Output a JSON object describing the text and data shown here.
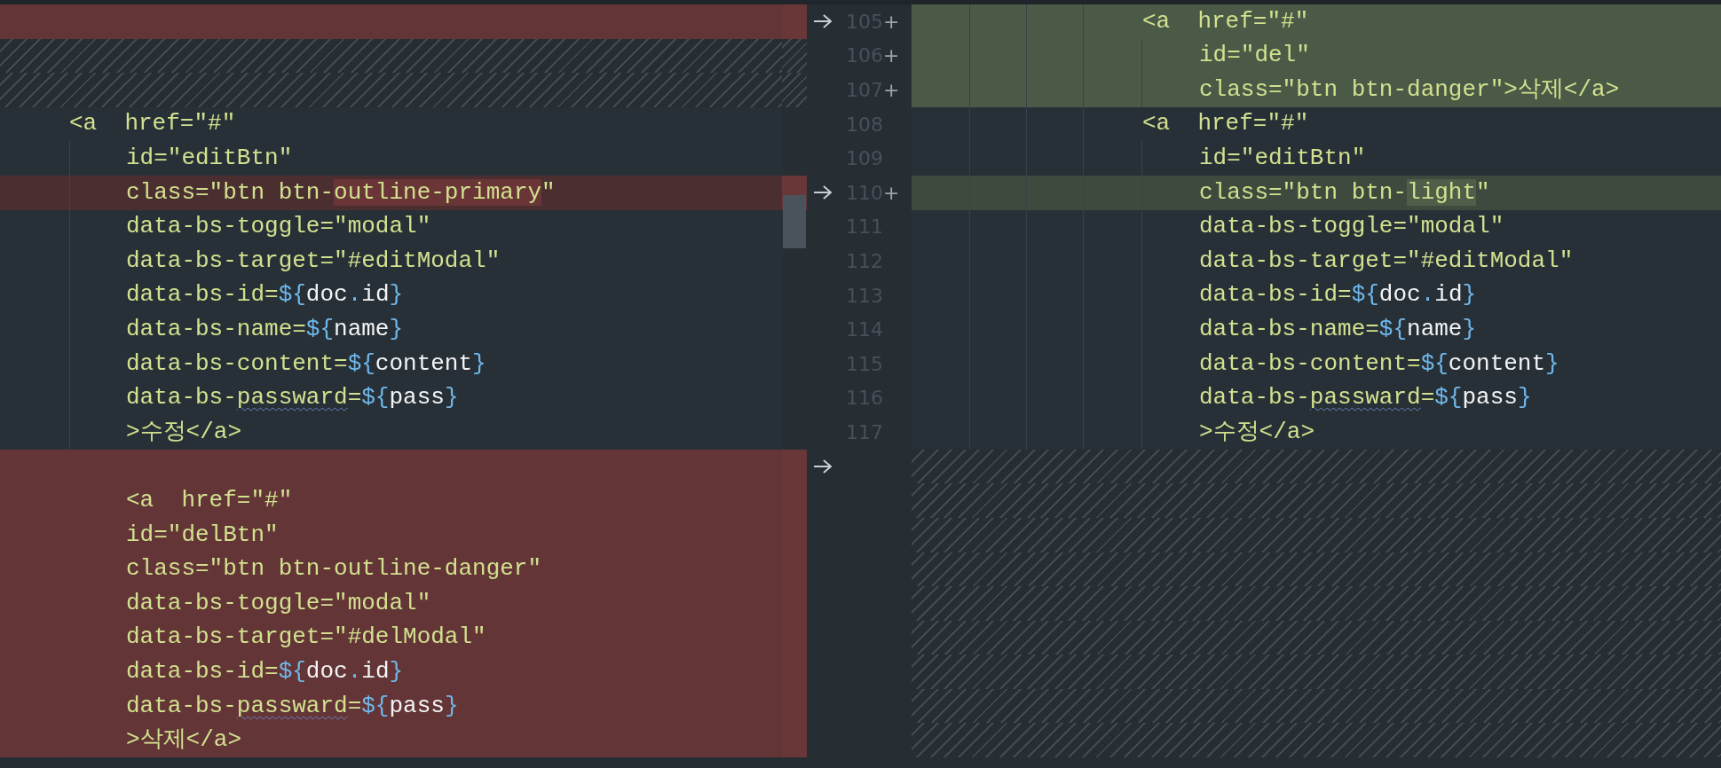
{
  "rows": [
    {
      "arrow": true,
      "left": {
        "kind": "removed",
        "indented": false
      },
      "right": {
        "number": "105",
        "marker": "+",
        "kind": "added",
        "indented": false,
        "tokens": [
          {
            "t": "<a  href=\"#\"",
            "kind": "plain"
          }
        ]
      }
    },
    {
      "arrow": false,
      "left": {
        "kind": "filler",
        "indented": false
      },
      "right": {
        "number": "106",
        "marker": "+",
        "kind": "added",
        "indented": true,
        "tokens": [
          {
            "t": "id=\"del\"",
            "kind": "plain"
          }
        ]
      }
    },
    {
      "arrow": false,
      "left": {
        "kind": "filler",
        "indented": false
      },
      "right": {
        "number": "107",
        "marker": "+",
        "kind": "added",
        "indented": true,
        "tokens": [
          {
            "t": "class=\"btn btn-danger\">삭제</a>",
            "kind": "plain"
          }
        ]
      }
    },
    {
      "arrow": false,
      "left": {
        "kind": "context",
        "indented": false,
        "tokens": [
          {
            "t": "<a  href=\"#\"",
            "kind": "plain"
          }
        ]
      },
      "right": {
        "number": "108",
        "kind": "context",
        "indented": false,
        "tokens": [
          {
            "t": "<a  href=\"#\"",
            "kind": "plain"
          }
        ]
      }
    },
    {
      "arrow": false,
      "left": {
        "kind": "context",
        "indented": true,
        "tokens": [
          {
            "t": "id=\"editBtn\"",
            "kind": "plain"
          }
        ]
      },
      "right": {
        "number": "109",
        "kind": "context",
        "indented": true,
        "tokens": [
          {
            "t": "id=\"editBtn\"",
            "kind": "plain"
          }
        ]
      }
    },
    {
      "arrow": true,
      "left": {
        "kind": "modified",
        "indented": true,
        "tokens": [
          {
            "t": "class=\"btn btn-",
            "kind": "plain"
          },
          {
            "t": "outline-primary",
            "kind": "changed"
          },
          {
            "t": "\"",
            "kind": "plain"
          }
        ]
      },
      "right": {
        "number": "110",
        "marker": "+",
        "kind": "modified",
        "indented": true,
        "tokens": [
          {
            "t": "class=\"btn btn-",
            "kind": "plain"
          },
          {
            "t": "light",
            "kind": "changed"
          },
          {
            "t": "\"",
            "kind": "plain"
          }
        ]
      }
    },
    {
      "arrow": false,
      "left": {
        "kind": "context",
        "indented": true,
        "tokens": [
          {
            "t": "data-bs-toggle=\"modal\"",
            "kind": "plain"
          }
        ]
      },
      "right": {
        "number": "111",
        "kind": "context",
        "indented": true,
        "tokens": [
          {
            "t": "data-bs-toggle=\"modal\"",
            "kind": "plain"
          }
        ]
      }
    },
    {
      "arrow": false,
      "left": {
        "kind": "context",
        "indented": true,
        "tokens": [
          {
            "t": "data-bs-target=\"#editModal\"",
            "kind": "plain"
          }
        ]
      },
      "right": {
        "number": "112",
        "kind": "context",
        "indented": true,
        "tokens": [
          {
            "t": "data-bs-target=\"#editModal\"",
            "kind": "plain"
          }
        ]
      }
    },
    {
      "arrow": false,
      "left": {
        "kind": "context",
        "indented": true,
        "tokens": [
          {
            "t": "data-bs-id=",
            "kind": "plain"
          },
          {
            "t": "${",
            "kind": "brace"
          },
          {
            "t": "doc",
            "kind": "name"
          },
          {
            "t": ".",
            "kind": "brace"
          },
          {
            "t": "id",
            "kind": "name"
          },
          {
            "t": "}",
            "kind": "brace"
          }
        ]
      },
      "right": {
        "number": "113",
        "kind": "context",
        "indented": true,
        "tokens": [
          {
            "t": "data-bs-id=",
            "kind": "plain"
          },
          {
            "t": "${",
            "kind": "brace"
          },
          {
            "t": "doc",
            "kind": "name"
          },
          {
            "t": ".",
            "kind": "brace"
          },
          {
            "t": "id",
            "kind": "name"
          },
          {
            "t": "}",
            "kind": "brace"
          }
        ]
      }
    },
    {
      "arrow": false,
      "left": {
        "kind": "context",
        "indented": true,
        "tokens": [
          {
            "t": "data-bs-name=",
            "kind": "plain"
          },
          {
            "t": "${",
            "kind": "brace"
          },
          {
            "t": "name",
            "kind": "name"
          },
          {
            "t": "}",
            "kind": "brace"
          }
        ]
      },
      "right": {
        "number": "114",
        "kind": "context",
        "indented": true,
        "tokens": [
          {
            "t": "data-bs-name=",
            "kind": "plain"
          },
          {
            "t": "${",
            "kind": "brace"
          },
          {
            "t": "name",
            "kind": "name"
          },
          {
            "t": "}",
            "kind": "brace"
          }
        ]
      }
    },
    {
      "arrow": false,
      "left": {
        "kind": "context",
        "indented": true,
        "tokens": [
          {
            "t": "data-bs-content=",
            "kind": "plain"
          },
          {
            "t": "${",
            "kind": "brace"
          },
          {
            "t": "content",
            "kind": "name"
          },
          {
            "t": "}",
            "kind": "brace"
          }
        ]
      },
      "right": {
        "number": "115",
        "kind": "context",
        "indented": true,
        "tokens": [
          {
            "t": "data-bs-content=",
            "kind": "plain"
          },
          {
            "t": "${",
            "kind": "brace"
          },
          {
            "t": "content",
            "kind": "name"
          },
          {
            "t": "}",
            "kind": "brace"
          }
        ]
      }
    },
    {
      "arrow": false,
      "left": {
        "kind": "context",
        "indented": true,
        "tokens": [
          {
            "t": "data-bs-",
            "kind": "plain"
          },
          {
            "t": "passward",
            "kind": "misspelled"
          },
          {
            "t": "=",
            "kind": "plain"
          },
          {
            "t": "${",
            "kind": "brace"
          },
          {
            "t": "pass",
            "kind": "name"
          },
          {
            "t": "}",
            "kind": "brace"
          }
        ]
      },
      "right": {
        "number": "116",
        "kind": "context",
        "indented": true,
        "tokens": [
          {
            "t": "data-bs-",
            "kind": "plain"
          },
          {
            "t": "passward",
            "kind": "misspelled"
          },
          {
            "t": "=",
            "kind": "plain"
          },
          {
            "t": "${",
            "kind": "brace"
          },
          {
            "t": "pass",
            "kind": "name"
          },
          {
            "t": "}",
            "kind": "brace"
          }
        ]
      }
    },
    {
      "arrow": false,
      "left": {
        "kind": "context",
        "indented": true,
        "tokens": [
          {
            "t": ">수정</a>",
            "kind": "plain"
          }
        ]
      },
      "right": {
        "number": "117",
        "kind": "context",
        "indented": true,
        "tokens": [
          {
            "t": ">수정</a>",
            "kind": "plain"
          }
        ]
      }
    },
    {
      "arrow": true,
      "left": {
        "kind": "removed",
        "indented": false
      },
      "right": {
        "kind": "filler",
        "indented": false
      }
    },
    {
      "arrow": false,
      "left": {
        "kind": "removed",
        "indented": true,
        "tokens": [
          {
            "t": "<a  href=\"#\"",
            "kind": "plain"
          }
        ]
      },
      "right": {
        "kind": "filler",
        "indented": false
      }
    },
    {
      "arrow": false,
      "left": {
        "kind": "removed",
        "indented": true,
        "tokens": [
          {
            "t": "id=\"delBtn\"",
            "kind": "plain"
          }
        ]
      },
      "right": {
        "kind": "filler",
        "indented": false
      }
    },
    {
      "arrow": false,
      "left": {
        "kind": "removed",
        "indented": true,
        "tokens": [
          {
            "t": "class=\"btn btn-outline-danger\"",
            "kind": "plain"
          }
        ]
      },
      "right": {
        "kind": "filler",
        "indented": false
      }
    },
    {
      "arrow": false,
      "left": {
        "kind": "removed",
        "indented": true,
        "tokens": [
          {
            "t": "data-bs-toggle=\"modal\"",
            "kind": "plain"
          }
        ]
      },
      "right": {
        "kind": "filler",
        "indented": false
      }
    },
    {
      "arrow": false,
      "left": {
        "kind": "removed",
        "indented": true,
        "tokens": [
          {
            "t": "data-bs-target=\"#delModal\"",
            "kind": "plain"
          }
        ]
      },
      "right": {
        "kind": "filler",
        "indented": false
      }
    },
    {
      "arrow": false,
      "left": {
        "kind": "removed",
        "indented": true,
        "tokens": [
          {
            "t": "data-bs-id=",
            "kind": "plain"
          },
          {
            "t": "${",
            "kind": "brace"
          },
          {
            "t": "doc",
            "kind": "name"
          },
          {
            "t": ".",
            "kind": "brace"
          },
          {
            "t": "id",
            "kind": "name"
          },
          {
            "t": "}",
            "kind": "brace"
          }
        ]
      },
      "right": {
        "kind": "filler",
        "indented": false
      }
    },
    {
      "arrow": false,
      "left": {
        "kind": "removed",
        "indented": true,
        "tokens": [
          {
            "t": "data-bs-",
            "kind": "plain"
          },
          {
            "t": "passward",
            "kind": "misspelled"
          },
          {
            "t": "=",
            "kind": "plain"
          },
          {
            "t": "${",
            "kind": "brace"
          },
          {
            "t": "pass",
            "kind": "name"
          },
          {
            "t": "}",
            "kind": "brace"
          }
        ]
      },
      "right": {
        "kind": "filler",
        "indented": false
      }
    },
    {
      "arrow": false,
      "left": {
        "kind": "removed",
        "indented": true,
        "tokens": [
          {
            "t": ">삭제</a>",
            "kind": "plain"
          }
        ]
      },
      "right": {
        "kind": "filler",
        "indented": false
      }
    }
  ]
}
